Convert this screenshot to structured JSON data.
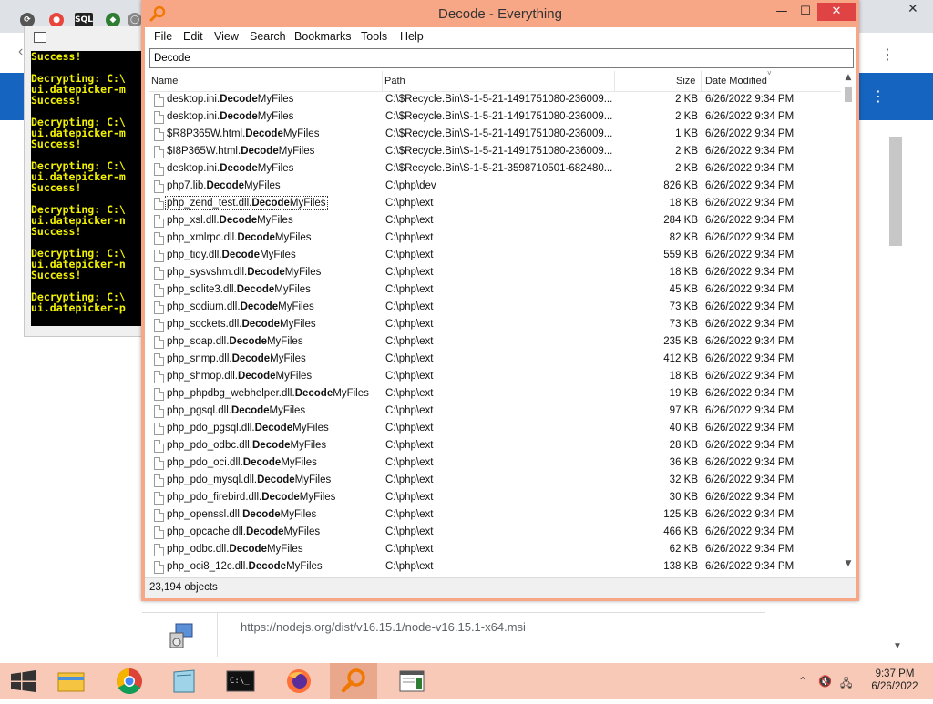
{
  "everything": {
    "title": "Decode - Everything",
    "menu": [
      "File",
      "Edit",
      "View",
      "Search",
      "Bookmarks",
      "Tools",
      "Help"
    ],
    "search_value": "Decode",
    "columns": {
      "name": "Name",
      "path": "Path",
      "size": "Size",
      "date": "Date Modified"
    },
    "match_term": "Decode",
    "rows": [
      {
        "pre": "desktop.ini.",
        "match": "Decode",
        "post": "MyFiles",
        "path": "C:\\$Recycle.Bin\\S-1-5-21-1491751080-236009...",
        "size": "2 KB",
        "date": "6/26/2022 9:34 PM"
      },
      {
        "pre": "desktop.ini.",
        "match": "Decode",
        "post": "MyFiles",
        "path": "C:\\$Recycle.Bin\\S-1-5-21-1491751080-236009...",
        "size": "2 KB",
        "date": "6/26/2022 9:34 PM"
      },
      {
        "pre": "$R8P365W.html.",
        "match": "Decode",
        "post": "MyFiles",
        "path": "C:\\$Recycle.Bin\\S-1-5-21-1491751080-236009...",
        "size": "1 KB",
        "date": "6/26/2022 9:34 PM"
      },
      {
        "pre": "$I8P365W.html.",
        "match": "Decode",
        "post": "MyFiles",
        "path": "C:\\$Recycle.Bin\\S-1-5-21-1491751080-236009...",
        "size": "2 KB",
        "date": "6/26/2022 9:34 PM"
      },
      {
        "pre": "desktop.ini.",
        "match": "Decode",
        "post": "MyFiles",
        "path": "C:\\$Recycle.Bin\\S-1-5-21-3598710501-682480...",
        "size": "2 KB",
        "date": "6/26/2022 9:34 PM"
      },
      {
        "pre": "php7.lib.",
        "match": "Decode",
        "post": "MyFiles",
        "path": "C:\\php\\dev",
        "size": "826 KB",
        "date": "6/26/2022 9:34 PM"
      },
      {
        "pre": "php_zend_test.dll.",
        "match": "Decode",
        "post": "MyFiles",
        "path": "C:\\php\\ext",
        "size": "18 KB",
        "date": "6/26/2022 9:34 PM"
      },
      {
        "pre": "php_xsl.dll.",
        "match": "Decode",
        "post": "MyFiles",
        "path": "C:\\php\\ext",
        "size": "284 KB",
        "date": "6/26/2022 9:34 PM"
      },
      {
        "pre": "php_xmlrpc.dll.",
        "match": "Decode",
        "post": "MyFiles",
        "path": "C:\\php\\ext",
        "size": "82 KB",
        "date": "6/26/2022 9:34 PM"
      },
      {
        "pre": "php_tidy.dll.",
        "match": "Decode",
        "post": "MyFiles",
        "path": "C:\\php\\ext",
        "size": "559 KB",
        "date": "6/26/2022 9:34 PM"
      },
      {
        "pre": "php_sysvshm.dll.",
        "match": "Decode",
        "post": "MyFiles",
        "path": "C:\\php\\ext",
        "size": "18 KB",
        "date": "6/26/2022 9:34 PM"
      },
      {
        "pre": "php_sqlite3.dll.",
        "match": "Decode",
        "post": "MyFiles",
        "path": "C:\\php\\ext",
        "size": "45 KB",
        "date": "6/26/2022 9:34 PM"
      },
      {
        "pre": "php_sodium.dll.",
        "match": "Decode",
        "post": "MyFiles",
        "path": "C:\\php\\ext",
        "size": "73 KB",
        "date": "6/26/2022 9:34 PM"
      },
      {
        "pre": "php_sockets.dll.",
        "match": "Decode",
        "post": "MyFiles",
        "path": "C:\\php\\ext",
        "size": "73 KB",
        "date": "6/26/2022 9:34 PM"
      },
      {
        "pre": "php_soap.dll.",
        "match": "Decode",
        "post": "MyFiles",
        "path": "C:\\php\\ext",
        "size": "235 KB",
        "date": "6/26/2022 9:34 PM"
      },
      {
        "pre": "php_snmp.dll.",
        "match": "Decode",
        "post": "MyFiles",
        "path": "C:\\php\\ext",
        "size": "412 KB",
        "date": "6/26/2022 9:34 PM"
      },
      {
        "pre": "php_shmop.dll.",
        "match": "Decode",
        "post": "MyFiles",
        "path": "C:\\php\\ext",
        "size": "18 KB",
        "date": "6/26/2022 9:34 PM"
      },
      {
        "pre": "php_phpdbg_webhelper.dll.",
        "match": "Decode",
        "post": "MyFiles",
        "path": "C:\\php\\ext",
        "size": "19 KB",
        "date": "6/26/2022 9:34 PM"
      },
      {
        "pre": "php_pgsql.dll.",
        "match": "Decode",
        "post": "MyFiles",
        "path": "C:\\php\\ext",
        "size": "97 KB",
        "date": "6/26/2022 9:34 PM"
      },
      {
        "pre": "php_pdo_pgsql.dll.",
        "match": "Decode",
        "post": "MyFiles",
        "path": "C:\\php\\ext",
        "size": "40 KB",
        "date": "6/26/2022 9:34 PM"
      },
      {
        "pre": "php_pdo_odbc.dll.",
        "match": "Decode",
        "post": "MyFiles",
        "path": "C:\\php\\ext",
        "size": "28 KB",
        "date": "6/26/2022 9:34 PM"
      },
      {
        "pre": "php_pdo_oci.dll.",
        "match": "Decode",
        "post": "MyFiles",
        "path": "C:\\php\\ext",
        "size": "36 KB",
        "date": "6/26/2022 9:34 PM"
      },
      {
        "pre": "php_pdo_mysql.dll.",
        "match": "Decode",
        "post": "MyFiles",
        "path": "C:\\php\\ext",
        "size": "32 KB",
        "date": "6/26/2022 9:34 PM"
      },
      {
        "pre": "php_pdo_firebird.dll.",
        "match": "Decode",
        "post": "MyFiles",
        "path": "C:\\php\\ext",
        "size": "30 KB",
        "date": "6/26/2022 9:34 PM"
      },
      {
        "pre": "php_openssl.dll.",
        "match": "Decode",
        "post": "MyFiles",
        "path": "C:\\php\\ext",
        "size": "125 KB",
        "date": "6/26/2022 9:34 PM"
      },
      {
        "pre": "php_opcache.dll.",
        "match": "Decode",
        "post": "MyFiles",
        "path": "C:\\php\\ext",
        "size": "466 KB",
        "date": "6/26/2022 9:34 PM"
      },
      {
        "pre": "php_odbc.dll.",
        "match": "Decode",
        "post": "MyFiles",
        "path": "C:\\php\\ext",
        "size": "62 KB",
        "date": "6/26/2022 9:34 PM"
      },
      {
        "pre": "php_oci8_12c.dll.",
        "match": "Decode",
        "post": "MyFiles",
        "path": "C:\\php\\ext",
        "size": "138 KB",
        "date": "6/26/2022 9:34 PM"
      }
    ],
    "status": "23,194 objects"
  },
  "console": {
    "lines": [
      "Success!",
      "",
      "Decrypting: C:\\",
      "ui.datepicker-m",
      "Success!",
      "",
      "Decrypting: C:\\",
      "ui.datepicker-m",
      "Success!",
      "",
      "Decrypting: C:\\",
      "ui.datepicker-m",
      "Success!",
      "",
      "Decrypting: C:\\",
      "ui.datepicker-n",
      "Success!",
      "",
      "Decrypting: C:\\",
      "ui.datepicker-n",
      "Success!",
      "",
      "Decrypting: C:\\",
      "ui.datepicker-p"
    ]
  },
  "download": {
    "url": "https://nodejs.org/dist/v16.15.1/node-v16.15.1-x64.msi"
  },
  "taskbar": {
    "time": "9:37 PM",
    "date": "6/26/2022",
    "apps": [
      "start-icon",
      "file-explorer-icon",
      "chrome-icon",
      "notepad-icon",
      "cmd-icon",
      "firefox-icon",
      "everything-icon",
      "document-icon"
    ]
  },
  "colors": {
    "accent_frame": "#f8a786",
    "taskbar": "#f7c9b6",
    "console_text": "#f2f200",
    "close_button": "#e04343"
  }
}
